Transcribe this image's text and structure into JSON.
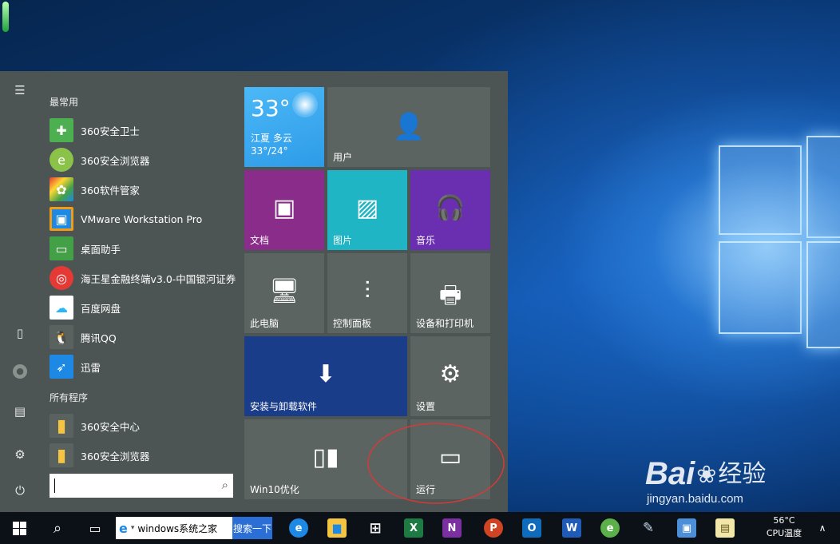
{
  "start_menu": {
    "most_used_title": "最常用",
    "all_programs_title": "所有程序",
    "most_used": [
      {
        "label": "360安全卫士",
        "icon": "360-safe-guard-icon",
        "color": "#4caf50"
      },
      {
        "label": "360安全浏览器",
        "icon": "360-browser-icon",
        "color": "#8bc34a"
      },
      {
        "label": "360软件管家",
        "icon": "360-software-manager-icon",
        "color": "#ff9800"
      },
      {
        "label": "VMware Workstation Pro",
        "icon": "vmware-icon",
        "color": "#1e88e5"
      },
      {
        "label": "桌面助手",
        "icon": "desktop-assistant-icon",
        "color": "#43a047"
      },
      {
        "label": "海王星金融终端v3.0-中国银河证券",
        "icon": "neptune-finance-icon",
        "color": "#e53935"
      },
      {
        "label": "百度网盘",
        "icon": "baidu-netdisk-icon",
        "color": "#29b6f6"
      },
      {
        "label": "腾讯QQ",
        "icon": "qq-icon",
        "color": "#222222"
      },
      {
        "label": "迅雷",
        "icon": "xunlei-icon",
        "color": "#1e88e5"
      }
    ],
    "all_programs": [
      {
        "label": "360安全中心",
        "icon": "folder-icon",
        "color": "#f5c542"
      },
      {
        "label": "360安全浏览器",
        "icon": "folder-icon",
        "color": "#f5c542"
      }
    ],
    "rail_icons": [
      "hamburger-menu-icon",
      "tablet-mode-icon",
      "user-avatar-icon",
      "file-explorer-icon",
      "settings-gear-icon",
      "power-icon"
    ]
  },
  "tiles": {
    "weather": {
      "temp": "33°",
      "location": "江夏 多云",
      "range": "33°/24°",
      "color": "#35a6f0"
    },
    "user": {
      "label": "用户"
    },
    "documents": {
      "label": "文档",
      "color": "#8a2c8a"
    },
    "pictures": {
      "label": "图片",
      "color": "#1fb5c4"
    },
    "music": {
      "label": "音乐",
      "color": "#6a2fb0"
    },
    "this_pc": {
      "label": "此电脑"
    },
    "control_panel": {
      "label": "控制面板"
    },
    "devices_printers": {
      "label": "设备和打印机"
    },
    "install_uninstall": {
      "label": "安装与卸载软件",
      "color": "#1a3d8a"
    },
    "settings": {
      "label": "设置"
    },
    "win10_optimize": {
      "label": "Win10优化"
    },
    "run": {
      "label": "运行"
    }
  },
  "taskbar": {
    "search_value": "windows系统之家",
    "search_button": "搜索一下",
    "pinned": [
      {
        "name": "edge-icon",
        "glyph": "e",
        "color": "#1e88e5"
      },
      {
        "name": "file-explorer-icon",
        "glyph": "▆",
        "color": "#f5c542"
      },
      {
        "name": "store-icon",
        "glyph": "⊞",
        "color": "#eeeeee"
      },
      {
        "name": "excel-icon",
        "glyph": "X",
        "color": "#1d7a43"
      },
      {
        "name": "onenote-icon",
        "glyph": "N",
        "color": "#7b2fa0"
      },
      {
        "name": "powerpoint-icon",
        "glyph": "P",
        "color": "#d04423"
      },
      {
        "name": "outlook-icon",
        "glyph": "O",
        "color": "#0f6cbd"
      },
      {
        "name": "word-icon",
        "glyph": "W",
        "color": "#1f5cb8"
      },
      {
        "name": "360-browser-taskbar-icon",
        "glyph": "e",
        "color": "#5bb04a"
      },
      {
        "name": "paint-icon",
        "glyph": "✎",
        "color": "#8aa8c8"
      },
      {
        "name": "remote-desktop-icon",
        "glyph": "▣",
        "color": "#4a8fd8"
      },
      {
        "name": "notepad-icon",
        "glyph": "▤",
        "color": "#f2e6a8"
      }
    ],
    "cpu_temp": "56°C",
    "cpu_label": "CPU温度"
  },
  "watermark": {
    "brand": "Bai",
    "suffix": "经验",
    "url": "jingyan.baidu.com"
  }
}
